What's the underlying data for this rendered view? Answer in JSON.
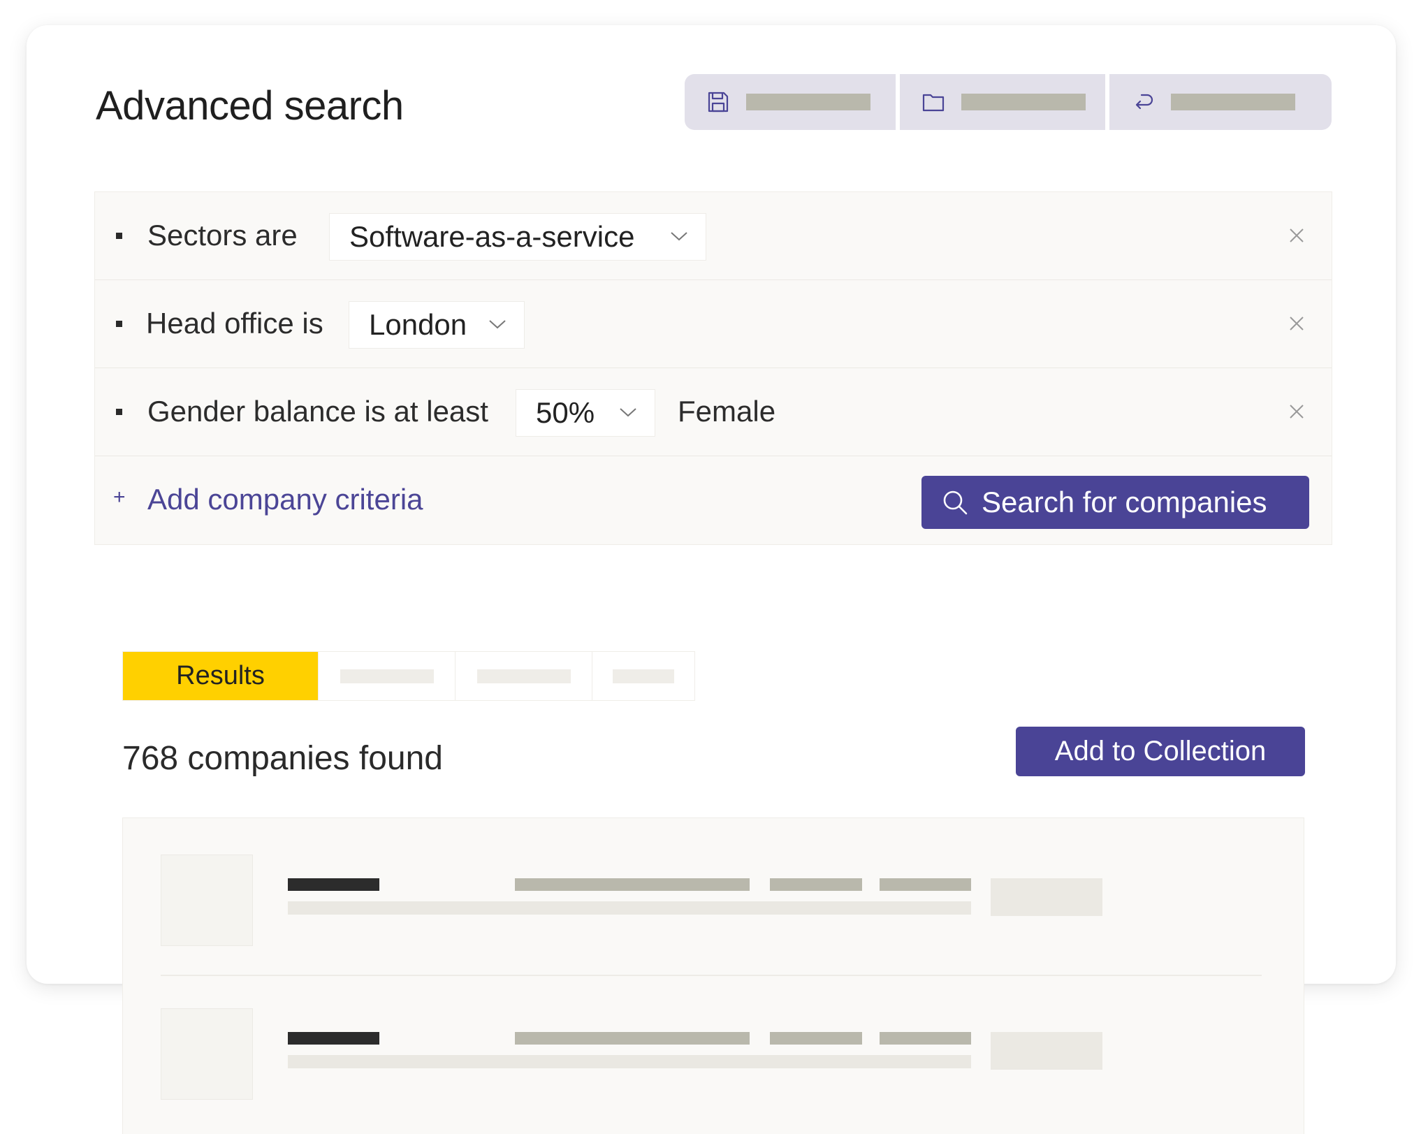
{
  "header": {
    "title": "Advanced search"
  },
  "toolbar": {
    "icons": [
      "save-icon",
      "folder-icon",
      "undo-icon"
    ]
  },
  "criteria": [
    {
      "label": "Sectors are",
      "value": "Software-as-a-service",
      "suffix": ""
    },
    {
      "label": "Head office is",
      "value": "London",
      "suffix": ""
    },
    {
      "label": "Gender balance is at least",
      "value": "50%",
      "suffix": "Female"
    }
  ],
  "add_criteria": {
    "label": "Add company criteria",
    "icon": "plus"
  },
  "search_button": {
    "label": "Search for companies",
    "icon": "search-icon"
  },
  "tabs": {
    "active_label": "Results"
  },
  "results": {
    "count_text": "768 companies found",
    "add_to_collection_label": "Add to Collection"
  },
  "colors": {
    "accent": "#4a4496",
    "active_tab": "#ffd000",
    "toolbar_bg": "#e2e0ea"
  }
}
